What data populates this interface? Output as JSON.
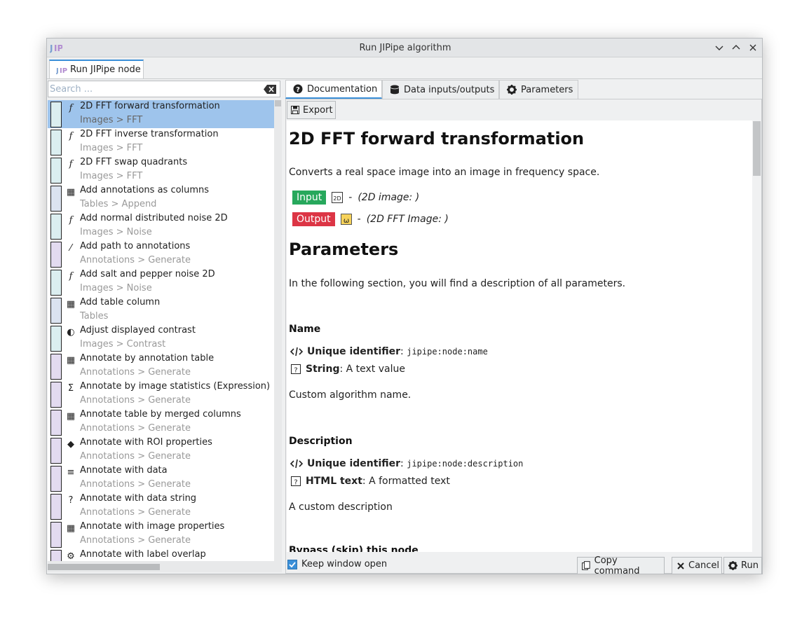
{
  "window": {
    "title": "Run JIPipe algorithm",
    "logo_text": "JIP"
  },
  "run_tab": {
    "label": "Run JIPipe node"
  },
  "search": {
    "placeholder": "Search ..."
  },
  "list": [
    {
      "name": "2D FFT forward transformation",
      "category": "Images > FFT",
      "color": "#dbeef0",
      "icon": "function-icon",
      "glyph": "f",
      "selected": true
    },
    {
      "name": "2D FFT inverse transformation",
      "category": "Images > FFT",
      "color": "#dbeef0",
      "icon": "function-icon",
      "glyph": "f"
    },
    {
      "name": "2D FFT swap quadrants",
      "category": "Images > FFT",
      "color": "#dbeef0",
      "icon": "function-icon",
      "glyph": "f"
    },
    {
      "name": "Add annotations as columns",
      "category": "Tables > Append",
      "color": "#dbe3f0",
      "icon": "table-add-icon",
      "glyph": "▦"
    },
    {
      "name": "Add normal distributed noise 2D",
      "category": "Images > Noise",
      "color": "#dbeef0",
      "icon": "function-icon",
      "glyph": "f"
    },
    {
      "name": "Add path to annotations",
      "category": "Annotations > Generate",
      "color": "#e3dbf0",
      "icon": "magic-wand-icon",
      "glyph": "⁄"
    },
    {
      "name": "Add salt and pepper noise 2D",
      "category": "Images > Noise",
      "color": "#dbeef0",
      "icon": "function-icon",
      "glyph": "f"
    },
    {
      "name": "Add table column",
      "category": "Tables",
      "color": "#dbe3f0",
      "icon": "table-add-icon",
      "glyph": "▦"
    },
    {
      "name": "Adjust displayed contrast",
      "category": "Images > Contrast",
      "color": "#dbeef0",
      "icon": "contrast-icon",
      "glyph": "◐"
    },
    {
      "name": "Annotate by annotation table",
      "category": "Annotations > Generate",
      "color": "#e3dbf0",
      "icon": "table-icon",
      "glyph": "▦"
    },
    {
      "name": "Annotate by image statistics (Expression)",
      "category": "Annotations > Generate",
      "color": "#e3dbf0",
      "icon": "sigma-icon",
      "glyph": "Σ"
    },
    {
      "name": "Annotate table by merged columns",
      "category": "Annotations > Generate",
      "color": "#e3dbf0",
      "icon": "table-icon",
      "glyph": "▦"
    },
    {
      "name": "Annotate with ROI properties",
      "category": "Annotations > Generate",
      "color": "#e3dbf0",
      "icon": "tag-icon",
      "glyph": "◆"
    },
    {
      "name": "Annotate with data",
      "category": "Annotations > Generate",
      "color": "#e3dbf0",
      "icon": "database-icon",
      "glyph": "≡"
    },
    {
      "name": "Annotate with data string",
      "category": "Annotations > Generate",
      "color": "#e3dbf0",
      "icon": "question-box-icon",
      "glyph": "?"
    },
    {
      "name": "Annotate with image properties",
      "category": "Annotations > Generate",
      "color": "#e3dbf0",
      "icon": "table-icon",
      "glyph": "▦"
    },
    {
      "name": "Annotate with label overlap",
      "category": "",
      "color": "#e3dbf0",
      "icon": "gear-icon",
      "glyph": "⚙"
    }
  ],
  "tabs": [
    {
      "label": "Documentation",
      "icon": "help-icon"
    },
    {
      "label": "Data inputs/outputs",
      "icon": "database-icon"
    },
    {
      "label": "Parameters",
      "icon": "gear-icon"
    }
  ],
  "export": {
    "label": "Export"
  },
  "doc": {
    "title": "2D FFT forward transformation",
    "description": "Converts a real space image into an image in frequency space.",
    "input": {
      "badge": "Input",
      "type_glyph": "2D",
      "text": "(2D image: )"
    },
    "output": {
      "badge": "Output",
      "type_glyph": "ω",
      "text": "(2D FFT Image: )"
    },
    "dash": "-",
    "params_heading": "Parameters",
    "params_intro": "In the following section, you will find a description of all parameters.",
    "params": [
      {
        "title": "Name",
        "id_label": "Unique identifier",
        "id_value": "jipipe:node:name",
        "type_label": "String",
        "type_desc": "A text value",
        "desc": "Custom algorithm name."
      },
      {
        "title": "Description",
        "id_label": "Unique identifier",
        "id_value": "jipipe:node:description",
        "type_label": "HTML text",
        "type_desc": "A formatted text",
        "desc": "A custom description"
      }
    ],
    "next_cut": "Bypass (skip) this node"
  },
  "footer": {
    "keep_open": "Keep window open",
    "copy": "Copy command",
    "cancel": "Cancel",
    "run": "Run"
  },
  "colors": {
    "accent": "#3a8fd8",
    "input_badge": "#27a85c",
    "output_badge": "#dc3545",
    "selection": "#9ec4ec"
  }
}
